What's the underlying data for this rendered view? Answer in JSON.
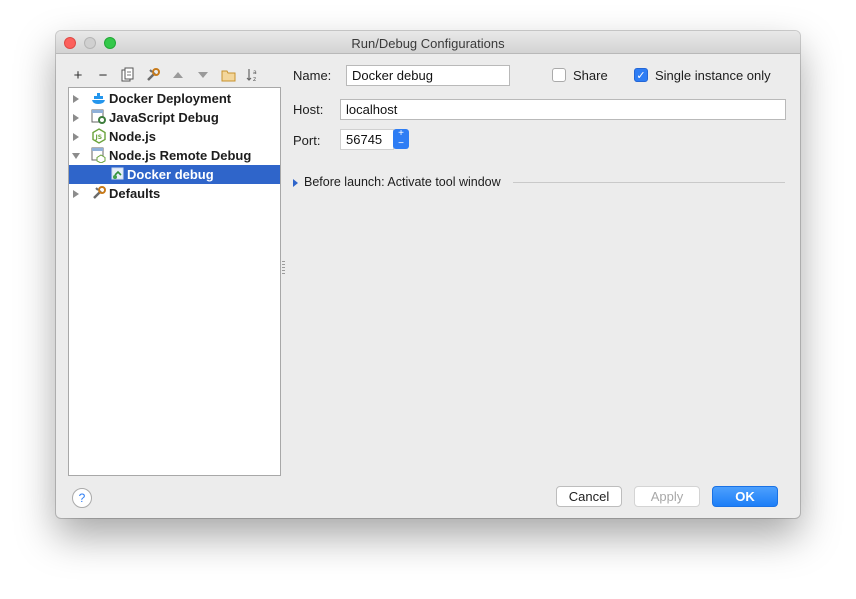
{
  "window": {
    "title": "Run/Debug Configurations"
  },
  "toolbar": {
    "icons": [
      "add-icon",
      "remove-icon",
      "copy-icon",
      "wrench-icon",
      "move-up-icon",
      "move-down-icon",
      "folder-icon",
      "sort-alpha-icon"
    ],
    "add_glyph": "+",
    "remove_glyph": "−"
  },
  "tree": {
    "items": [
      {
        "label": "Docker Deployment",
        "icon": "docker-icon",
        "expanded": false
      },
      {
        "label": "JavaScript Debug",
        "icon": "js-debug-icon",
        "expanded": false
      },
      {
        "label": "Node.js",
        "icon": "nodejs-icon",
        "expanded": false
      },
      {
        "label": "Node.js Remote Debug",
        "icon": "nodejs-remote-icon",
        "expanded": true
      },
      {
        "label": "Docker debug",
        "icon": "remote-debug-icon",
        "selected": true
      },
      {
        "label": "Defaults",
        "icon": "wrench-icon",
        "expanded": false
      }
    ]
  },
  "form": {
    "name_label": "Name:",
    "name_value": "Docker debug",
    "share_label": "Share",
    "share_checked": false,
    "single_instance_label": "Single instance only",
    "single_instance_checked": true,
    "host_label": "Host:",
    "host_value": "localhost",
    "port_label": "Port:",
    "port_value": "56745",
    "before_launch": "Before launch: Activate tool window"
  },
  "buttons": {
    "help": "?",
    "cancel": "Cancel",
    "apply": "Apply",
    "ok": "OK"
  },
  "colors": {
    "accent": "#2e7df4",
    "selection": "#2f65ca"
  }
}
